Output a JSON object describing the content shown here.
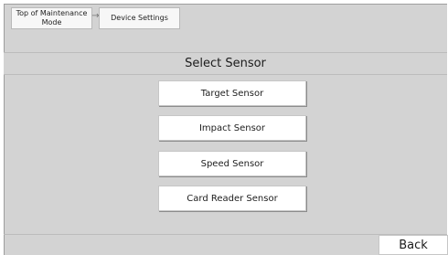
{
  "breadcrumb": {
    "items": [
      {
        "label": "Top of Maintenance Mode"
      },
      {
        "label": "Device Settings"
      }
    ],
    "separator": "→"
  },
  "title": "Select Sensor",
  "sensors": [
    {
      "label": "Target Sensor"
    },
    {
      "label": "Impact Sensor"
    },
    {
      "label": "Speed Sensor"
    },
    {
      "label": "Card Reader Sensor"
    }
  ],
  "footer": {
    "back_label": "Back"
  },
  "colors": {
    "panel_background": "#d3d3d3",
    "button_background": "#ffffff",
    "text": "#1b1b1b"
  }
}
